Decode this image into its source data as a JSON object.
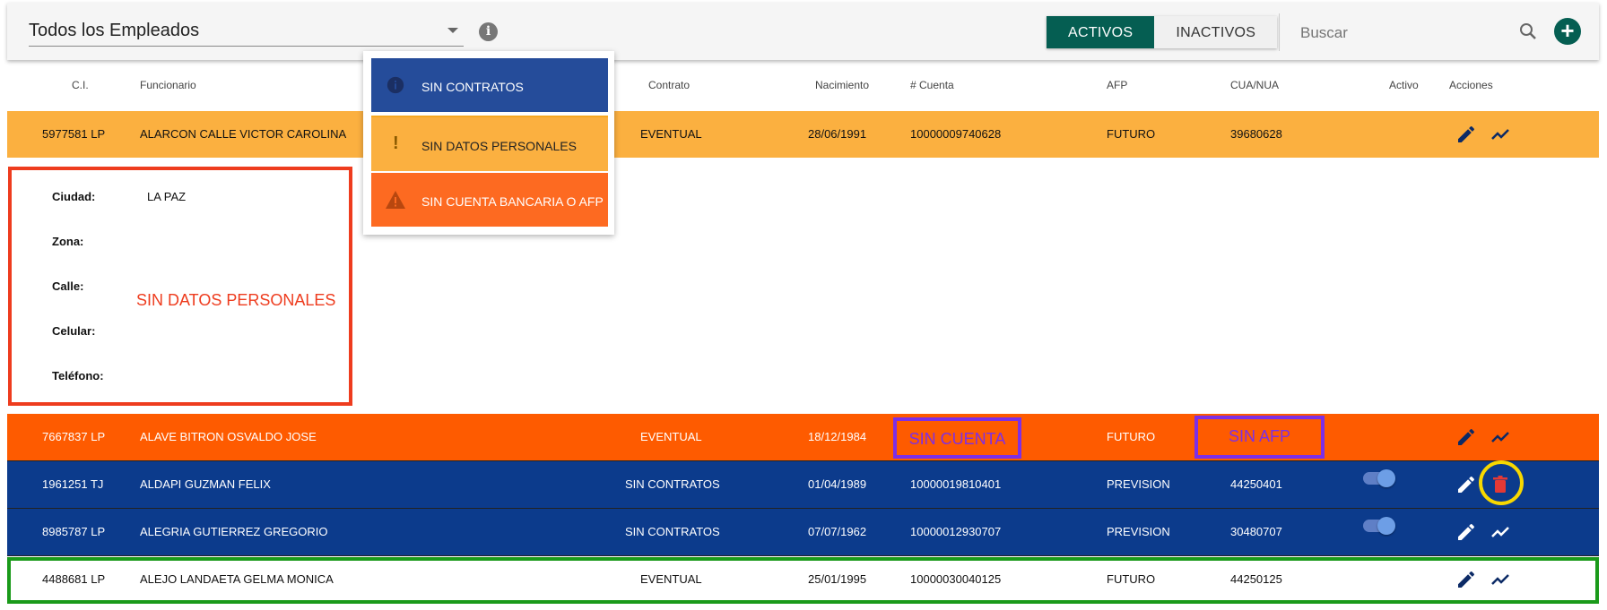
{
  "toolbar": {
    "employee_filter": "Todos los Empleados",
    "tabs": [
      {
        "label": "ACTIVOS",
        "active": true
      },
      {
        "label": "INACTIVOS",
        "active": false
      }
    ],
    "search_placeholder": "Buscar"
  },
  "legend_popup": [
    {
      "label": "SIN CONTRATOS",
      "icon": "info-icon",
      "color": "#254c9a"
    },
    {
      "label": "SIN DATOS PERSONALES",
      "icon": "exclamation-icon",
      "color": "#fbb040"
    },
    {
      "label": "SIN CUENTA BANCARIA O AFP",
      "icon": "warning-icon",
      "color": "#fd6a21"
    }
  ],
  "table": {
    "headers": [
      "C.I.",
      "Funcionario",
      "Contrato",
      "Nacimiento",
      "# Cuenta",
      "AFP",
      "CUA/NUA",
      "Activo",
      "Acciones"
    ],
    "rows": [
      {
        "ci": "5977581 LP",
        "funcionario": "ALARCON CALLE VICTOR CAROLINA",
        "contrato": "EVENTUAL",
        "nacimiento": "28/06/1991",
        "cuenta": "10000009740628",
        "afp": "FUTURO",
        "cua": "39680628",
        "status": "sin-datos-personales"
      },
      {
        "ci": "7667837 LP",
        "funcionario": "ALAVE BITRON OSVALDO JOSE",
        "contrato": "EVENTUAL",
        "nacimiento": "18/12/1984",
        "cuenta": "",
        "afp": "FUTURO",
        "cua": "",
        "status": "sin-cuenta-afp"
      },
      {
        "ci": "1961251 TJ",
        "funcionario": "ALDAPI GUZMAN FELIX",
        "contrato": "SIN CONTRATOS",
        "nacimiento": "01/04/1989",
        "cuenta": "10000019810401",
        "afp": "PREVISION",
        "cua": "44250401",
        "status": "sin-contratos"
      },
      {
        "ci": "8985787 LP",
        "funcionario": "ALEGRIA GUTIERREZ GREGORIO",
        "contrato": "SIN CONTRATOS",
        "nacimiento": "07/07/1962",
        "cuenta": "10000012930707",
        "afp": "PREVISION",
        "cua": "30480707",
        "status": "sin-contratos"
      },
      {
        "ci": "4488681 LP",
        "funcionario": "ALEJO LANDAETA GELMA MONICA",
        "contrato": "EVENTUAL",
        "nacimiento": "25/01/1995",
        "cuenta": "10000030040125",
        "afp": "FUTURO",
        "cua": "44250125",
        "status": "ok"
      }
    ]
  },
  "detail": {
    "ciudad_label": "Ciudad:",
    "ciudad_value": "LA PAZ",
    "zona_label": "Zona:",
    "calle_label": "Calle:",
    "celular_label": "Celular:",
    "telefono_label": "Teléfono:"
  },
  "annotations": {
    "sin_datos": "SIN DATOS PERSONALES",
    "sin_cuenta": "SIN CUENTA",
    "sin_afp": "SIN AFP"
  },
  "colors": {
    "primary": "#055e52",
    "row_amber": "#fbb040",
    "row_orange": "#fe5b00",
    "row_blue": "#0c3b8c"
  }
}
